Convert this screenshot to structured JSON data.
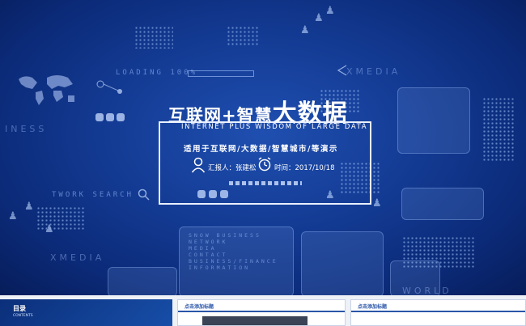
{
  "slide": {
    "title_cn_part1": "互联网+智慧",
    "title_cn_part2": "大数据",
    "title_en": "INTERNET PLUS WISDOM OF LARGE DATA",
    "subtitle": "适用于互联网/大数据/智慧城市/等演示",
    "reporter_label": "汇报人：张建松",
    "time_label": "时间：2017/10/18"
  },
  "background_text": {
    "loading": "LOADING 100%",
    "xmedia_top": "XMEDIA",
    "business": "INESS",
    "network_search": "TWORK SEARCH",
    "xmedia_bottom": "XMEDIA",
    "world": "WORLD",
    "panel_lines": [
      "SNOW BUSINESS",
      "NETWORK",
      "MEDIA",
      "CONTACT",
      "BUSINESS/FINANCE",
      "INFORMATION"
    ]
  },
  "thumbnails": [
    {
      "label": "目录",
      "sub": "CONTENTS"
    },
    {
      "label": "点击添加标题"
    },
    {
      "label": "点击添加标题"
    }
  ],
  "colors": {
    "background": "#143c95",
    "frame": "#e9f0ff",
    "text": "#ffffff"
  }
}
